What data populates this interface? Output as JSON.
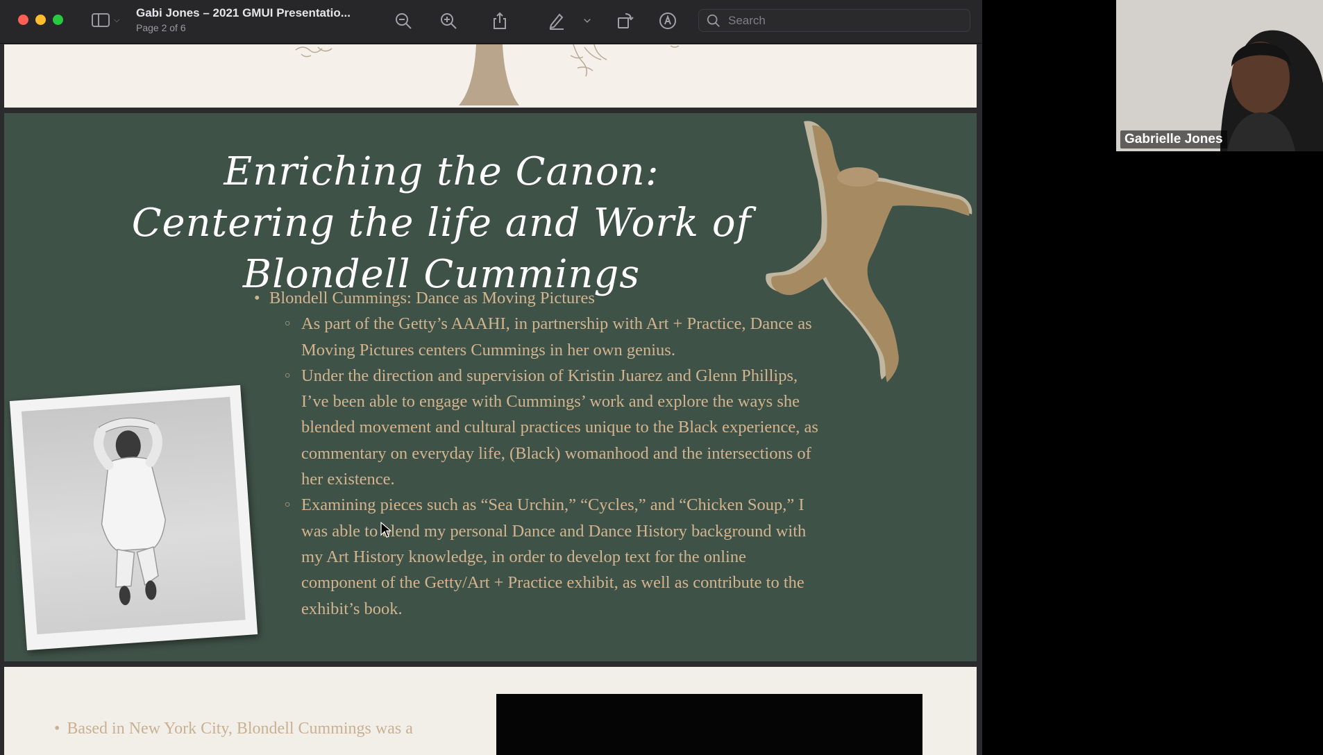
{
  "window": {
    "title": "Gabi Jones – 2021 GMUI Presentatio...",
    "page_indicator": "Page 2 of 6"
  },
  "toolbar": {
    "icons": [
      "sidebar-toggle-icon",
      "zoom-out-icon",
      "zoom-in-icon",
      "share-icon",
      "markup-pen-icon",
      "chevron-down-icon",
      "rotate-icon",
      "annotate-icon",
      "search-icon"
    ],
    "search_placeholder": "Search"
  },
  "slide": {
    "title_line1": "Enriching the Canon:",
    "title_line2": "Centering the life and Work of Blondell Cummings",
    "bullet_main": "Blondell Cummings: Dance as Moving Pictures",
    "sub_bullets": [
      "As part of the Getty’s AAAHI, in partnership with Art + Practice, Dance as Moving Pictures centers Cummings in her own genius.",
      "Under the direction and supervision of Kristin Juarez and Glenn Phillips, I’ve been able to engage with Cummings’ work and explore the ways she blended movement and cultural practices unique to the Black experience, as commentary on everyday life, (Black) womanhood and the intersections of her existence.",
      "Examining pieces such as “Sea Urchin,” “Cycles,” and “Chicken Soup,” I was able to blend my personal Dance  and Dance History background with my Art History knowledge, in order to develop text for the online component of the Getty/Art + Practice exhibit, as well as contribute to the exhibit’s book."
    ],
    "colors": {
      "background": "#3f5248",
      "text": "#d2b58e",
      "title": "#ffffff"
    }
  },
  "next_slide": {
    "bullet_partial": "Based in New York City, Blondell Cummings was a"
  },
  "participant": {
    "name": "Gabrielle Jones"
  }
}
